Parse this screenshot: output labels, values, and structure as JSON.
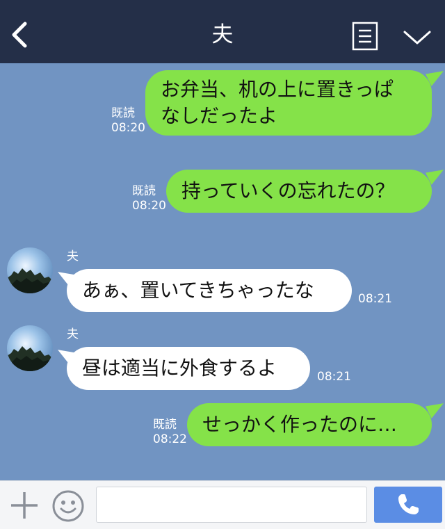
{
  "header": {
    "title": "夫",
    "background": "#242f48"
  },
  "colors": {
    "chat_background": "#7194c2",
    "sent_bubble": "#85e249",
    "received_bubble": "#ffffff",
    "call_button": "#5b8de4"
  },
  "messages": [
    {
      "direction": "sent",
      "lines": [
        "お弁当、机の上に置きっぱ",
        "なしだったよ"
      ],
      "read_label": "既読",
      "time": "08:20"
    },
    {
      "direction": "sent",
      "lines": [
        "持っていくの忘れたの？"
      ],
      "read_label": "既読",
      "time": "08:20"
    },
    {
      "direction": "received",
      "sender": "夫",
      "lines": [
        "あぁ、置いてきちゃったな"
      ],
      "time": "08:21"
    },
    {
      "direction": "received",
      "sender": "夫",
      "lines": [
        "昼は適当に外食するよ"
      ],
      "time": "08:21"
    },
    {
      "direction": "sent",
      "lines": [
        "せっかく作ったのに…"
      ],
      "read_label": "既読",
      "time": "08:22"
    }
  ],
  "footer": {
    "input_value": "",
    "input_placeholder": ""
  },
  "icons": {
    "back": "back-icon",
    "menu": "menu-icon",
    "expand": "chevron-down-icon",
    "add": "plus-icon",
    "emoji": "emoji-icon",
    "call": "phone-icon"
  }
}
